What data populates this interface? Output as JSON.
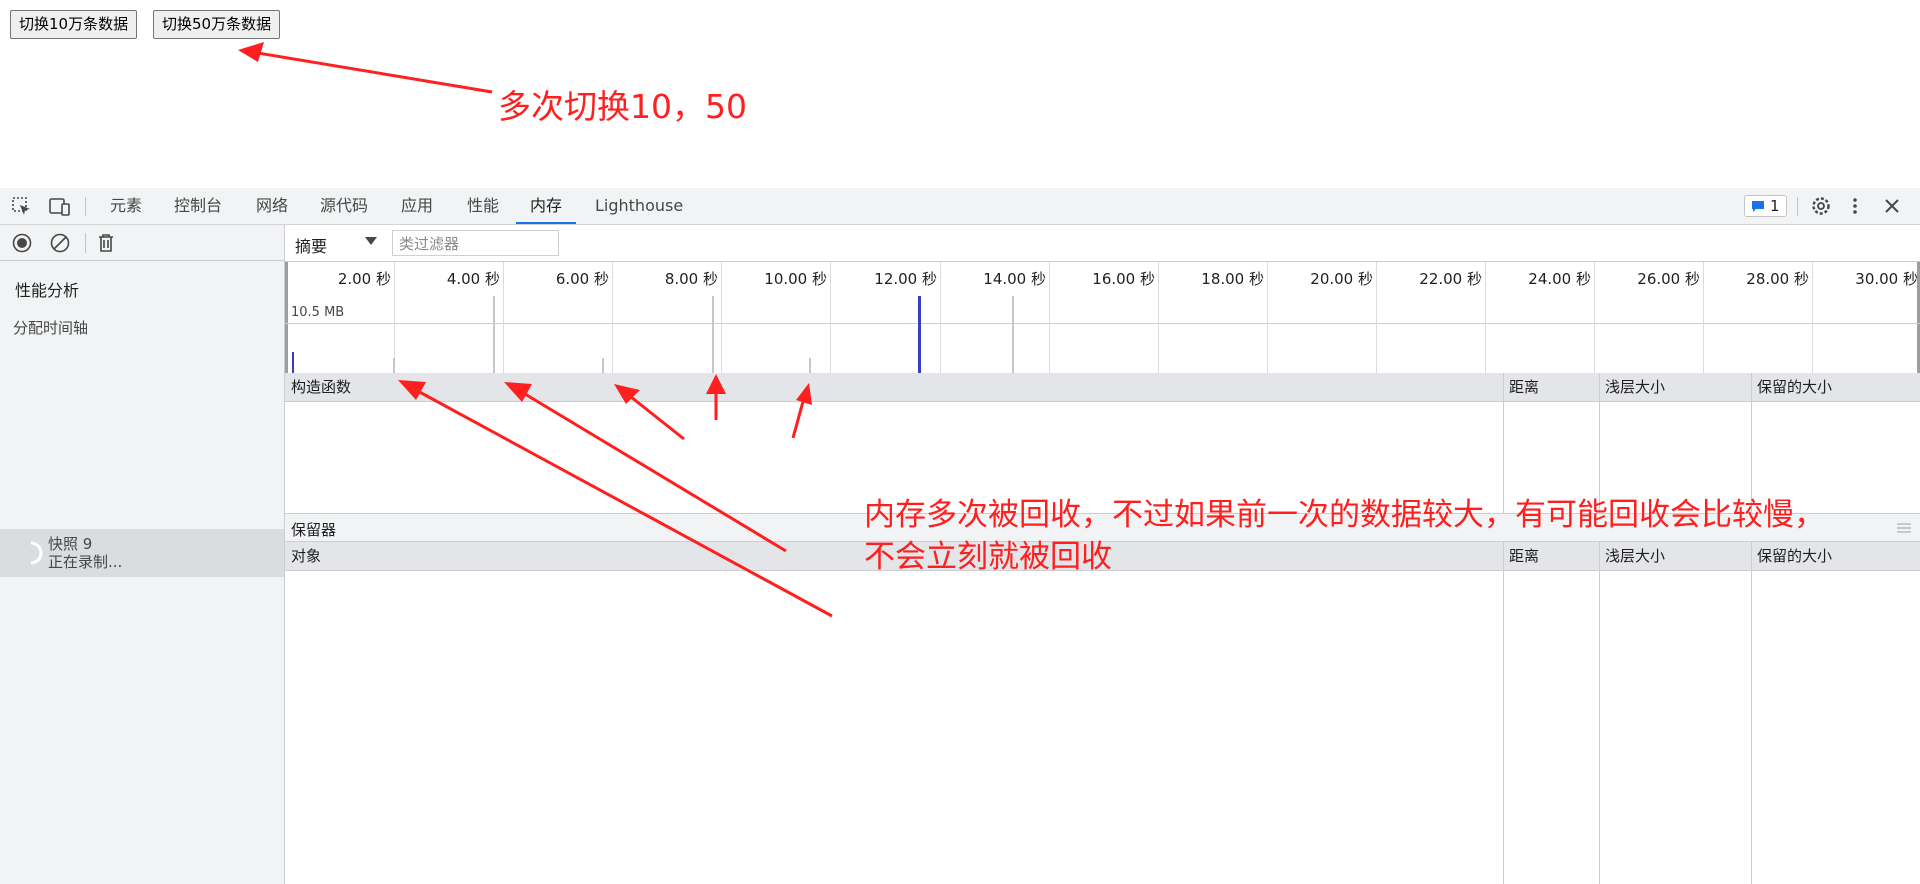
{
  "page": {
    "btn10": "切换10万条数据",
    "btn50": "切换50万条数据",
    "note_top": "多次切换10，50",
    "note_mid_line1": "内存多次被回收，不过如果前一次的数据较大，有可能回收会比较慢，",
    "note_mid_line2": "不会立刻就被回收"
  },
  "devtools": {
    "tabs": [
      "元素",
      "控制台",
      "网络",
      "源代码",
      "应用",
      "性能",
      "内存",
      "Lighthouse"
    ],
    "active_tab": "内存",
    "issues_count": "1",
    "view_select": "摘要",
    "class_filter_placeholder": "类过滤器",
    "sidebar": {
      "heading": "性能分析",
      "section": "分配时间轴",
      "snapshot_name": "快照 9",
      "snapshot_status": "正在录制..."
    },
    "timeline": {
      "ticks": [
        "2.00 秒",
        "4.00 秒",
        "6.00 秒",
        "8.00 秒",
        "10.00 秒",
        "12.00 秒",
        "14.00 秒",
        "16.00 秒",
        "18.00 秒",
        "20.00 秒",
        "22.00 秒",
        "24.00 秒",
        "26.00 秒",
        "28.00 秒",
        "30.00 秒"
      ],
      "max_label": "10.5 MB"
    },
    "constructors_table": {
      "col_constructor": "构造函数",
      "col_distance": "距离",
      "col_shallow": "浅层大小",
      "col_retained": "保留的大小"
    },
    "retainers": {
      "title": "保留器",
      "col_object": "对象",
      "col_distance": "距离",
      "col_shallow": "浅层大小",
      "col_retained": "保留的大小"
    }
  },
  "colors": {
    "annotation": "#ff1f1f",
    "accent": "#1a73e8",
    "alloc_blue": "#3c3cc0"
  }
}
